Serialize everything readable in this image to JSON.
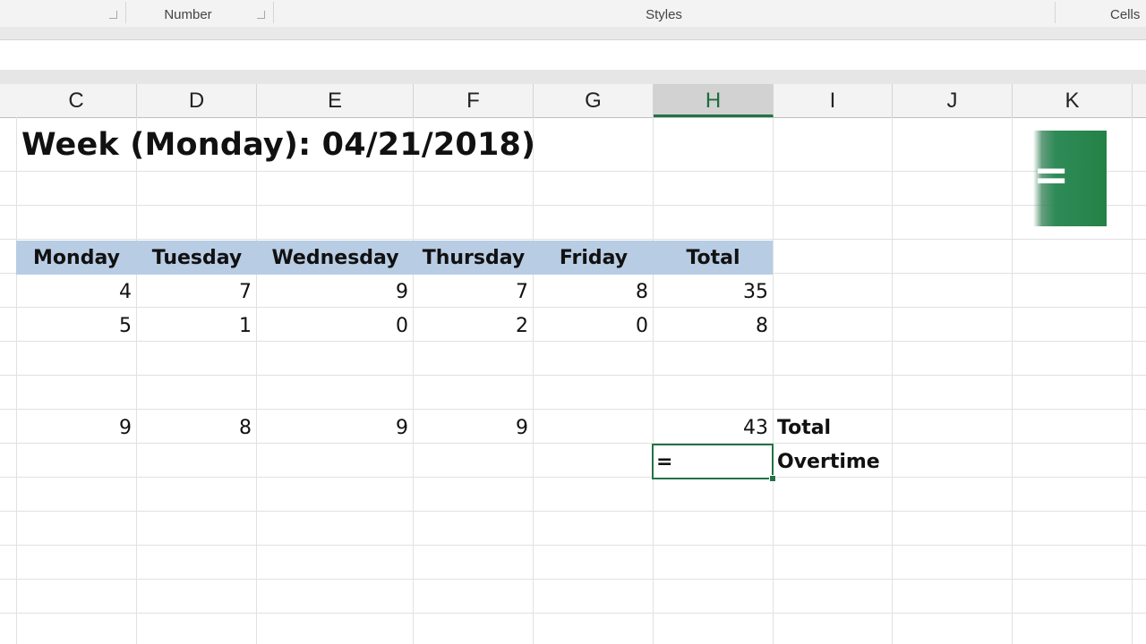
{
  "ribbon": {
    "groups": [
      {
        "label": ""
      },
      {
        "label": "Number"
      },
      {
        "label": "Styles"
      },
      {
        "label": "Cells"
      }
    ]
  },
  "columns": [
    "C",
    "D",
    "E",
    "F",
    "G",
    "H",
    "I",
    "J",
    "K"
  ],
  "active_column": "H",
  "title": "Week (Monday): 04/21/2018)",
  "table": {
    "headers": [
      "Monday",
      "Tuesday",
      "Wednesday",
      "Thursday",
      "Friday",
      "Total"
    ],
    "rows": [
      [
        "4",
        "7",
        "9",
        "7",
        "8",
        "35"
      ],
      [
        "5",
        "1",
        "0",
        "2",
        "0",
        "8"
      ]
    ],
    "summary_row": [
      "9",
      "8",
      "9",
      "9",
      "",
      "43"
    ],
    "summary_label": "Total",
    "overtime_label": "Overtime",
    "active_cell_value": "="
  },
  "badge": {
    "symbol": "="
  },
  "colors": {
    "header_fill": "#b8cce4",
    "accent": "#217346"
  }
}
